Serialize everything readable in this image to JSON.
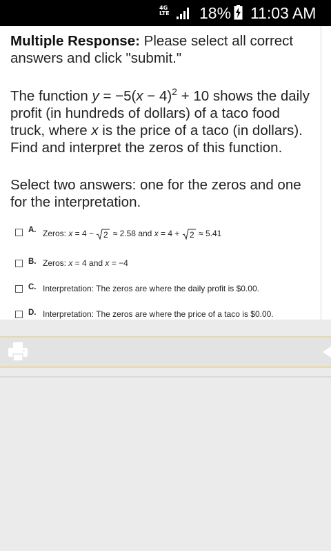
{
  "status_bar": {
    "network_label": "4G",
    "network_sub": "LTE",
    "battery_percent": "18%",
    "time": "11:03 AM"
  },
  "question": {
    "type_label": "Multiple Response:",
    "instruction": "Please select all correct answers and click \"submit.\"",
    "prompt_before_eq": "The function ",
    "eq_var": "y",
    "eq_mid1": " = −5(",
    "eq_x": "x",
    "eq_mid2": " − 4)",
    "eq_exp": "2",
    "eq_mid3": " + 10 shows the daily profit (in hundreds of dollars) of a taco food truck, where ",
    "eq_x2": "x",
    "eq_end": " is the price of a taco (in dollars). Find and interpret the zeros of this function.",
    "select_note": "Select two answers: one for the zeros and one for the interpretation."
  },
  "options": [
    {
      "letter": "A.",
      "checked": false,
      "prefix": "Zeros: ",
      "x1": "x",
      "part1": " = 4 − ",
      "rad1": "2",
      "part2": " ≈ 2.58 and ",
      "x2": "x",
      "part3": " = 4 + ",
      "rad2": "2",
      "part4": " ≈ 5.41"
    },
    {
      "letter": "B.",
      "checked": false,
      "prefix": "Zeros: ",
      "x1": "x",
      "part1": " = 4 and ",
      "x2": "x",
      "part2": " = −4"
    },
    {
      "letter": "C.",
      "checked": false,
      "text": "Interpretation: The zeros are where the daily profit is $0.00."
    },
    {
      "letter": "D.",
      "checked": false,
      "text": "Interpretation: The zeros are where the price of a taco is $0.00."
    }
  ],
  "toolbar": {
    "print_icon": "print-icon",
    "back_icon": "back-arrow-icon"
  }
}
